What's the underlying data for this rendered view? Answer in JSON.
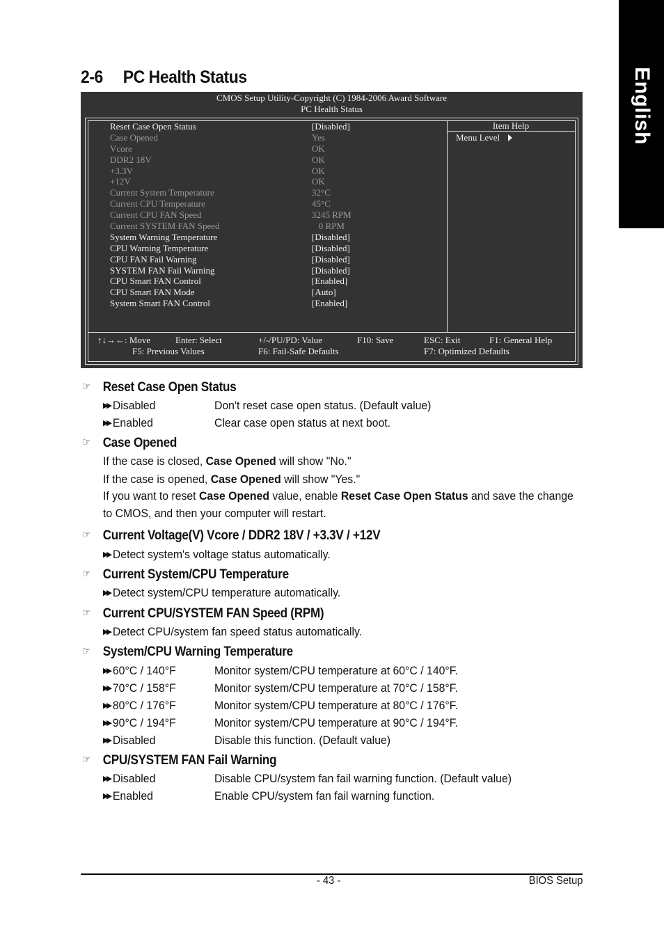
{
  "language_tab": "English",
  "page_title": {
    "number": "2-6",
    "text": "PC Health Status"
  },
  "bios": {
    "header_line1": "CMOS Setup Utility-Copyright (C) 1984-2006 Award Software",
    "header_line2": "PC Health Status",
    "item_help": "Item Help",
    "menu_level": "Menu Level",
    "rows": [
      {
        "label": "Reset Case Open Status",
        "value": "[Disabled]",
        "editable": true
      },
      {
        "label": "Case Opened",
        "value": "Yes",
        "editable": false
      },
      {
        "label": "Vcore",
        "value": "OK",
        "editable": false
      },
      {
        "label": "DDR2 18V",
        "value": "OK",
        "editable": false
      },
      {
        "label": "+3.3V",
        "value": "OK",
        "editable": false
      },
      {
        "label": "+12V",
        "value": "OK",
        "editable": false
      },
      {
        "label": "Current System Temperature",
        "value": "32°C",
        "editable": false
      },
      {
        "label": "Current CPU Temperature",
        "value": "45°C",
        "editable": false
      },
      {
        "label": "Current CPU FAN Speed",
        "value": "3245 RPM",
        "editable": false
      },
      {
        "label": "Current SYSTEM FAN Speed",
        "value": "   0 RPM",
        "editable": false
      },
      {
        "label": "System Warning Temperature",
        "value": "[Disabled]",
        "editable": true
      },
      {
        "label": "CPU Warning Temperature",
        "value": "[Disabled]",
        "editable": true
      },
      {
        "label": "CPU FAN Fail Warning",
        "value": "[Disabled]",
        "editable": true
      },
      {
        "label": "SYSTEM FAN Fail Warning",
        "value": "[Disabled]",
        "editable": true
      },
      {
        "label": "CPU Smart FAN Control",
        "value": "[Enabled]",
        "editable": true
      },
      {
        "label": "CPU Smart FAN Mode",
        "value": "[Auto]",
        "editable": true
      },
      {
        "label": "System Smart FAN Control",
        "value": "[Enabled]",
        "editable": true
      }
    ],
    "keys": {
      "move": "↑↓→←: Move",
      "enter": "Enter: Select",
      "value": "+/-/PU/PD: Value",
      "save": "F10: Save",
      "exit": "ESC: Exit",
      "help": "F1: General Help",
      "prev": "F5: Previous Values",
      "failsafe": "F6: Fail-Safe Defaults",
      "optimized": "F7: Optimized Defaults"
    }
  },
  "sections": {
    "reset_case": {
      "title": "Reset Case Open Status",
      "options": [
        {
          "name": "Disabled",
          "desc": "Don't reset case open status. (Default value)"
        },
        {
          "name": "Enabled",
          "desc": "Clear case open status at next boot."
        }
      ]
    },
    "case_opened": {
      "title": "Case Opened",
      "p1_pre": "If the case is closed, ",
      "p1_bold": "Case Opened",
      "p1_post": " will show \"No.\"",
      "p2_pre": "If the case is opened, ",
      "p2_bold": "Case Opened",
      "p2_post": " will show \"Yes.\"",
      "p3_pre": "If you want to reset ",
      "p3_bold1": "Case Opened",
      "p3_mid": " value, enable ",
      "p3_bold2": "Reset Case Open Status",
      "p3_post": " and save the change",
      "p4": "to CMOS, and then your computer will restart."
    },
    "voltage": {
      "title": "Current Voltage(V) Vcore / DDR2 18V / +3.3V / +12V",
      "desc": "Detect system's voltage status automatically."
    },
    "temperature": {
      "title": "Current System/CPU Temperature",
      "desc": "Detect system/CPU temperature automatically."
    },
    "fan_speed": {
      "title": "Current CPU/SYSTEM FAN Speed (RPM)",
      "desc": "Detect CPU/system fan speed status automatically."
    },
    "warning_temp": {
      "title": "System/CPU Warning Temperature",
      "options": [
        {
          "name": "60°C / 140°F",
          "desc": "Monitor system/CPU temperature at 60°C / 140°F."
        },
        {
          "name": "70°C / 158°F",
          "desc": "Monitor system/CPU temperature at 70°C / 158°F."
        },
        {
          "name": "80°C / 176°F",
          "desc": "Monitor system/CPU temperature at 80°C / 176°F."
        },
        {
          "name": "90°C / 194°F",
          "desc": "Monitor system/CPU temperature at 90°C / 194°F."
        },
        {
          "name": "Disabled",
          "desc": "Disable this function. (Default value)"
        }
      ]
    },
    "fan_fail": {
      "title": "CPU/SYSTEM FAN Fail Warning",
      "options": [
        {
          "name": "Disabled",
          "desc": "Disable CPU/system fan fail warning function. (Default value)"
        },
        {
          "name": "Enabled",
          "desc": "Enable CPU/system fan fail warning function."
        }
      ]
    }
  },
  "footer": {
    "page_number": "- 43 -",
    "section": "BIOS Setup"
  }
}
